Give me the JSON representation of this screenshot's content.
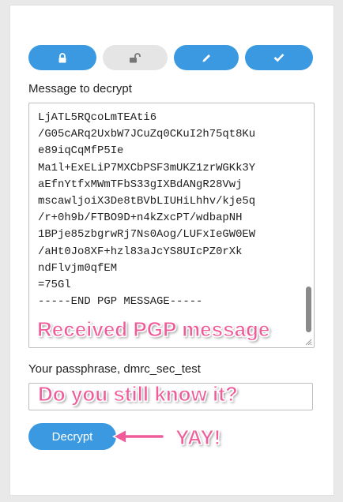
{
  "toolbar": {
    "buttons": [
      {
        "icon": "lock-icon",
        "state": "active"
      },
      {
        "icon": "unlock-icon",
        "state": "inactive"
      },
      {
        "icon": "pencil-icon",
        "state": "active"
      },
      {
        "icon": "checkmark-icon",
        "state": "active"
      }
    ]
  },
  "message": {
    "label": "Message to decrypt",
    "text": "LjATL5RQcoLmTEAti6\n/G05cARq2UxbW7JCuZq0CKuI2h75qt8Ku\ne89iqCqMfP5Ie\nMa1l+ExELiP7MXCbPSF3mUKZ1zrWGKk3Y\naEfnYtfxMWmTFbS33gIXBdANgR28Vwj\nmscawljoiX3De8tBVbLIUHiLhhv/kje5q\n/r+0h9b/FTBO9D+n4kZxcPT/wdbapNH\n1BPje85zbgrwRj7Ns0Aog/LUFxIeGW0EW\n/aHt0Jo8XF+hzl83aJcYS8UIcPZ0rXk\nndFlvjm0qfEM\n=75Gl\n-----END PGP MESSAGE-----"
  },
  "passphrase": {
    "label": "Your passphrase, dmrc_sec_test",
    "value": "",
    "placeholder": ""
  },
  "decrypt_button": {
    "label": "Decrypt"
  },
  "annotations": {
    "received": "Received PGP message",
    "still_know": "Do you still know it?",
    "yay": "YAY!"
  },
  "colors": {
    "accent": "#3a99e0",
    "inactive": "#e5e5e5",
    "annotation": "#f05b9a",
    "background": "#e9e9e9",
    "panel": "#ffffff"
  }
}
